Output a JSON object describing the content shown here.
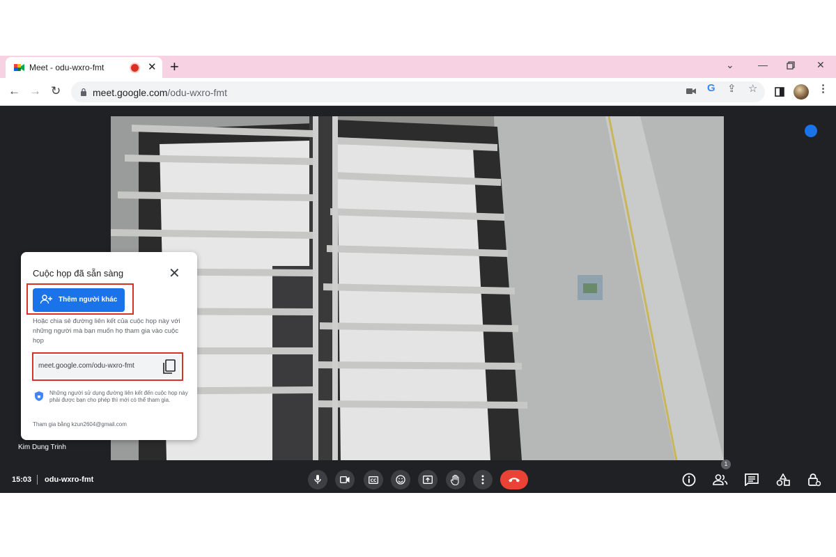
{
  "browser": {
    "tab_title": "Meet - odu-wxro-fmt",
    "url_host": "meet.google.com",
    "url_path": "/odu-wxro-fmt"
  },
  "dialog": {
    "title": "Cuộc họp đã sẵn sàng",
    "add_button": "Thêm người khác",
    "share_text": "Hoặc chia sẻ đường liên kết của cuộc họp này với những người mà bạn muốn họ tham gia vào cuộc họp",
    "link": "meet.google.com/odu-wxro-fmt",
    "note": "Những người sử dụng đường liên kết đến cuộc họp này phải được bạn cho phép thì mới có thể tham gia.",
    "joined_as": "Tham gia bằng kzun2604@gmail.com"
  },
  "participant": {
    "name": "Kim Dung Trinh"
  },
  "bottom_bar": {
    "time": "15:03",
    "meeting_code": "odu-wxro-fmt",
    "people_count": "1"
  },
  "colors": {
    "tab_strip": "#f6d2e3",
    "meet_background": "#202124",
    "accent_blue": "#1a73e8",
    "end_call_red": "#ea4335",
    "highlight_box": "#d93025"
  }
}
